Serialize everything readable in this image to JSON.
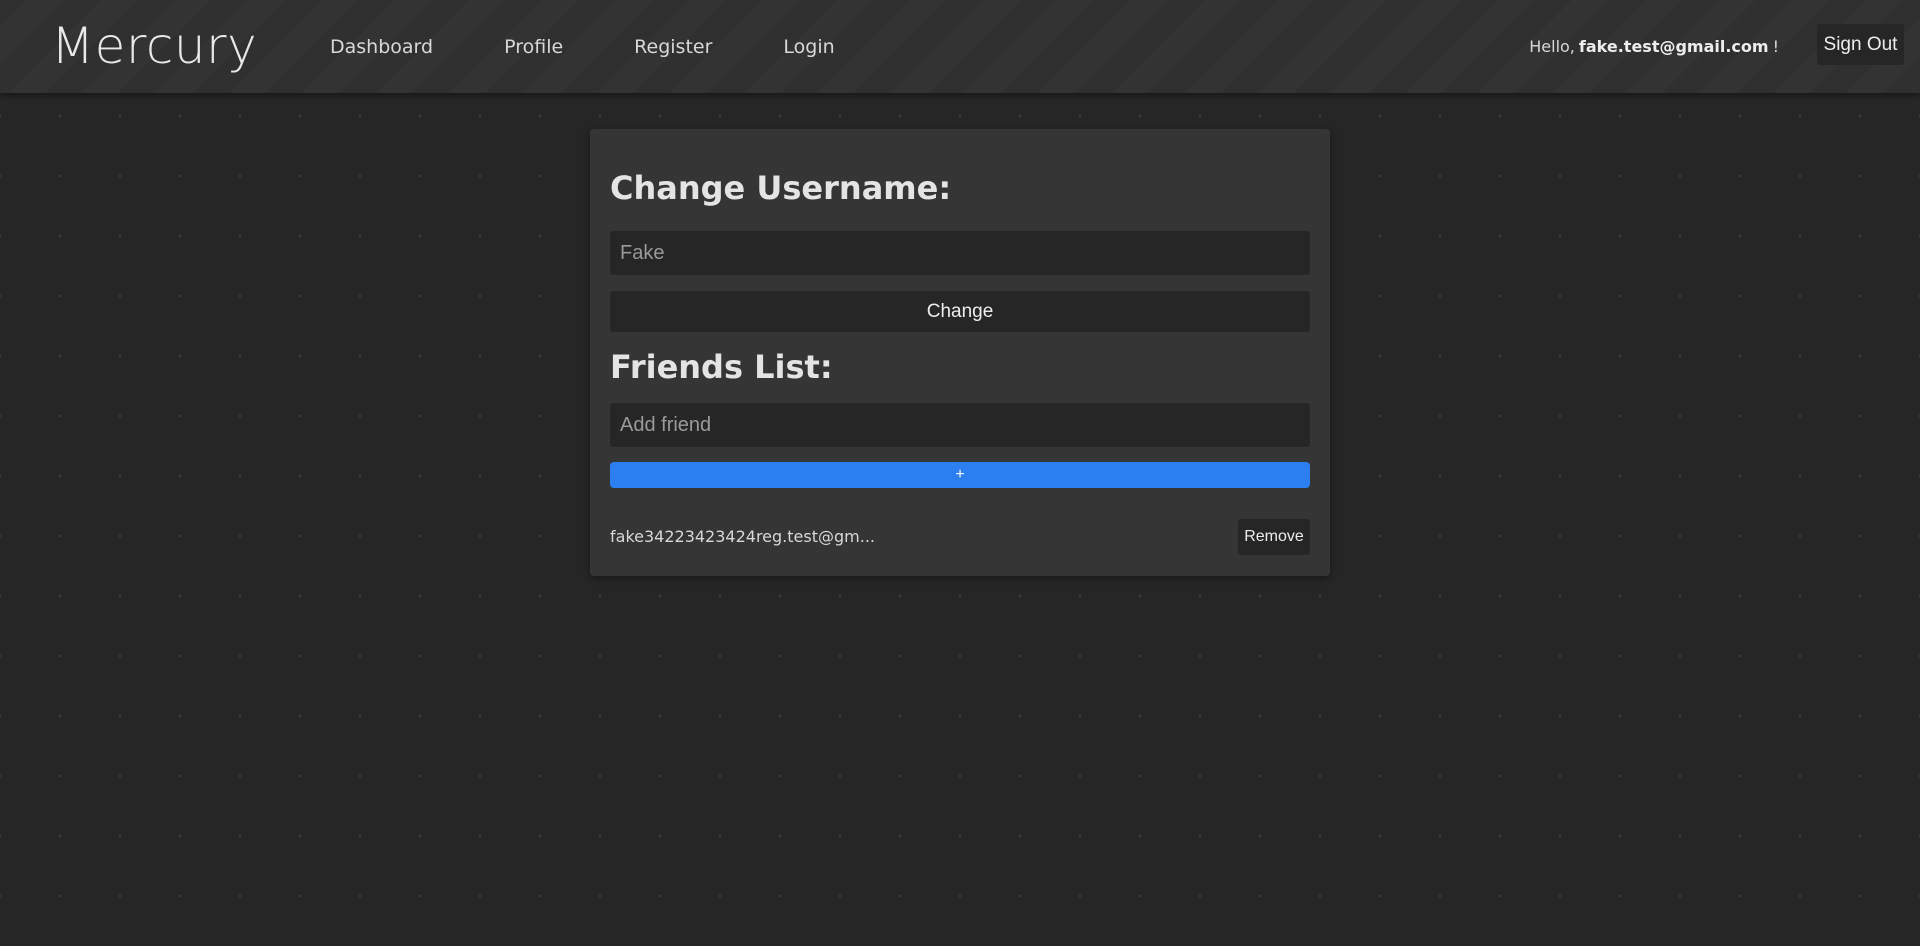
{
  "app": {
    "brand": "Mercury"
  },
  "nav": {
    "links": [
      {
        "label": "Dashboard"
      },
      {
        "label": "Profile"
      },
      {
        "label": "Register"
      },
      {
        "label": "Login"
      }
    ],
    "greeting": {
      "prefix": "Hello,",
      "email": "fake.test@gmail.com",
      "suffix": "!"
    },
    "sign_out_label": "Sign Out"
  },
  "profile": {
    "username_heading": "Change Username:",
    "username_placeholder": "Fake",
    "change_label": "Change",
    "friends_heading": "Friends List:",
    "friend_placeholder": "Add friend",
    "add_label": "+",
    "friends": [
      {
        "email": "fake34223423424reg.test@gm...",
        "remove_label": "Remove"
      }
    ]
  },
  "colors": {
    "background": "#262626",
    "navbar": "#333333",
    "card": "#353535",
    "accent": "#2b7ff0"
  }
}
